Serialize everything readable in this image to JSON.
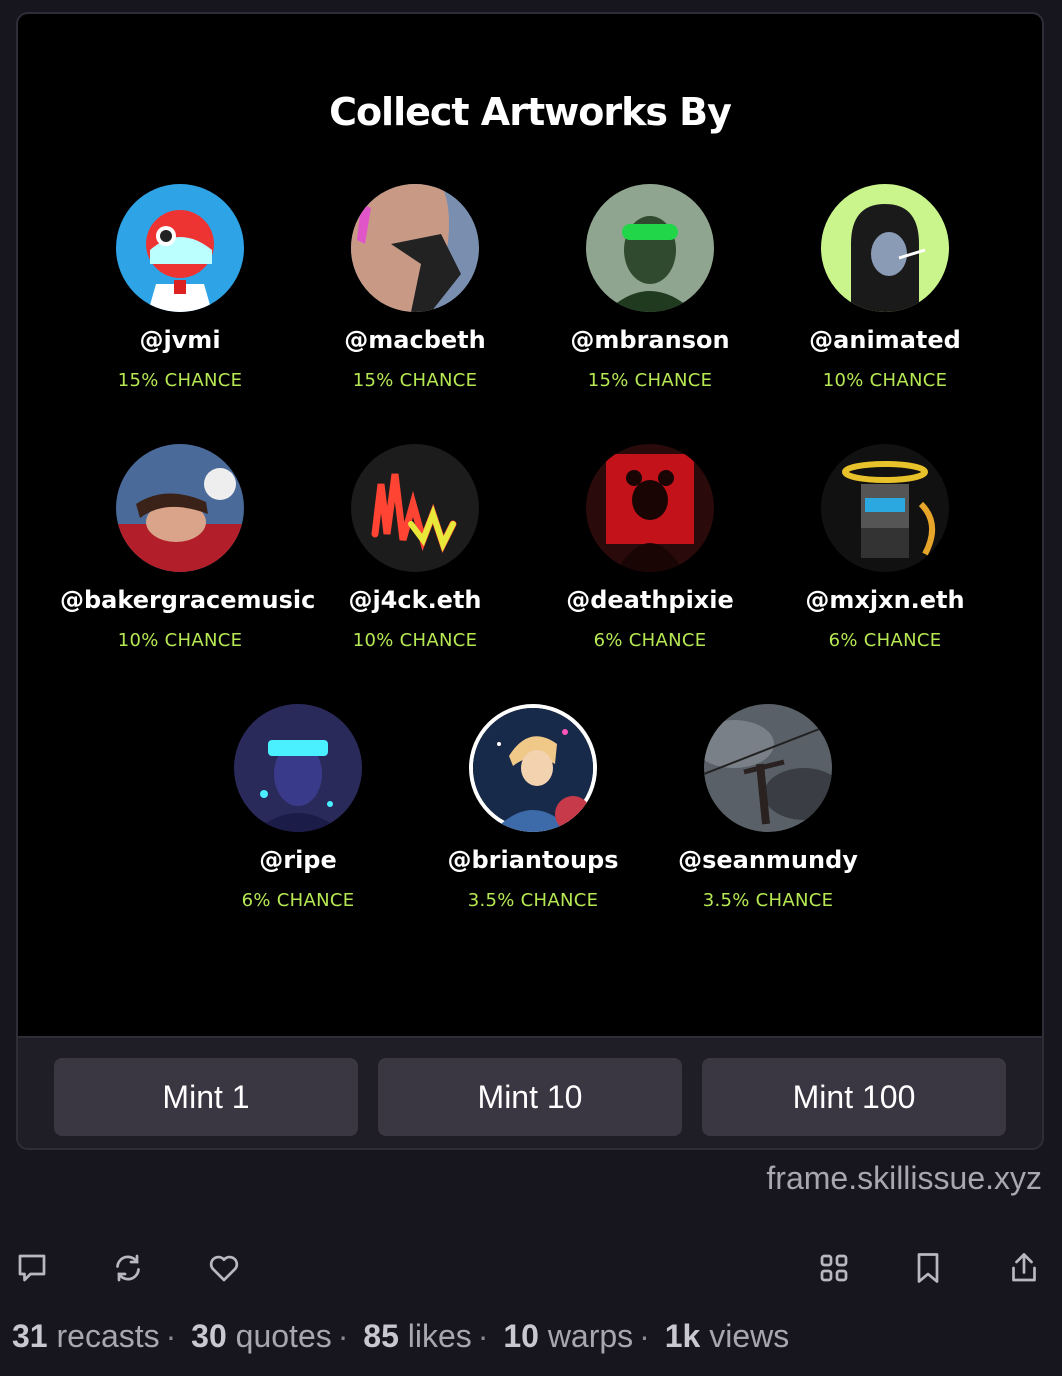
{
  "frame": {
    "title": "Collect Artworks By",
    "artists": [
      {
        "handle": "@jvmi",
        "chance": "15% CHANCE"
      },
      {
        "handle": "@macbeth",
        "chance": "15% CHANCE"
      },
      {
        "handle": "@mbranson",
        "chance": "15% CHANCE"
      },
      {
        "handle": "@animated",
        "chance": "10% CHANCE"
      },
      {
        "handle": "@bakergracemusic",
        "chance": "10% CHANCE"
      },
      {
        "handle": "@j4ck.eth",
        "chance": "10% CHANCE"
      },
      {
        "handle": "@deathpixie",
        "chance": "6% CHANCE"
      },
      {
        "handle": "@mxjxn.eth",
        "chance": "6% CHANCE"
      },
      {
        "handle": "@ripe",
        "chance": "6% CHANCE"
      },
      {
        "handle": "@briantoups",
        "chance": "3.5% CHANCE"
      },
      {
        "handle": "@seanmundy",
        "chance": "3.5% CHANCE"
      }
    ],
    "buttons": [
      "Mint 1",
      "Mint 10",
      "Mint 100"
    ]
  },
  "domain": "frame.skillissue.xyz",
  "actions": {
    "icons": [
      "comment-icon",
      "recast-icon",
      "like-icon",
      "grid-icon",
      "bookmark-icon",
      "share-icon"
    ]
  },
  "stats": {
    "recasts_count": "31",
    "recasts_label": "recasts",
    "quotes_count": "30",
    "quotes_label": "quotes",
    "likes_count": "85",
    "likes_label": "likes",
    "warps_count": "10",
    "warps_label": "warps",
    "views_count": "1k",
    "views_label": "views",
    "separator": "·"
  },
  "colors": {
    "accent": "#b5e853",
    "background": "#17151d",
    "button": "#3a3642"
  }
}
